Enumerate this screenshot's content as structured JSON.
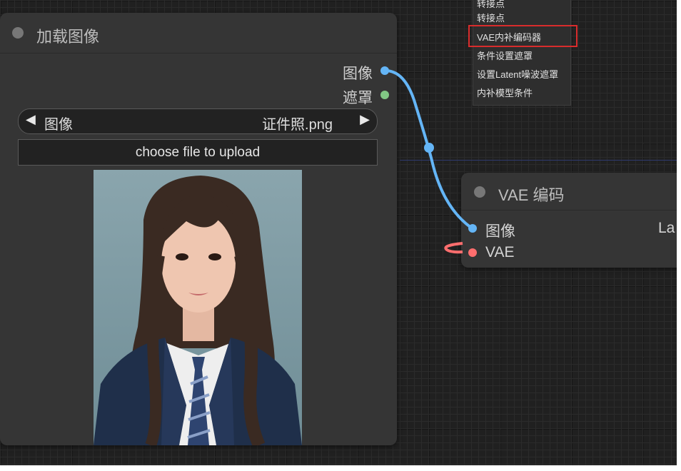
{
  "load_image_node": {
    "title": "加载图像",
    "outputs": [
      {
        "label": "图像",
        "color": "#64b5f6"
      },
      {
        "label": "遮罩",
        "color": "#81c784"
      }
    ],
    "image_widget": {
      "label": "图像",
      "value": "证件照.png"
    },
    "upload_label": "choose file to upload"
  },
  "vae_encode_node": {
    "title": "VAE 编码",
    "inputs": [
      {
        "label": "图像",
        "color": "#64b5f6"
      },
      {
        "label": "VAE",
        "color": "#ff6e6e"
      }
    ],
    "output_partial": "La"
  },
  "context_menu": {
    "items": [
      "转接点",
      "转接点",
      "VAE内补编码器",
      "条件设置遮罩",
      "设置Latent噪波遮罩",
      "内补模型条件"
    ],
    "highlighted_index": 2
  },
  "colors": {
    "canvas": "#202020",
    "node": "#353535",
    "image_link": "#64b5f6",
    "vae_link": "#ff6e6e",
    "highlight": "#d92c2c"
  }
}
